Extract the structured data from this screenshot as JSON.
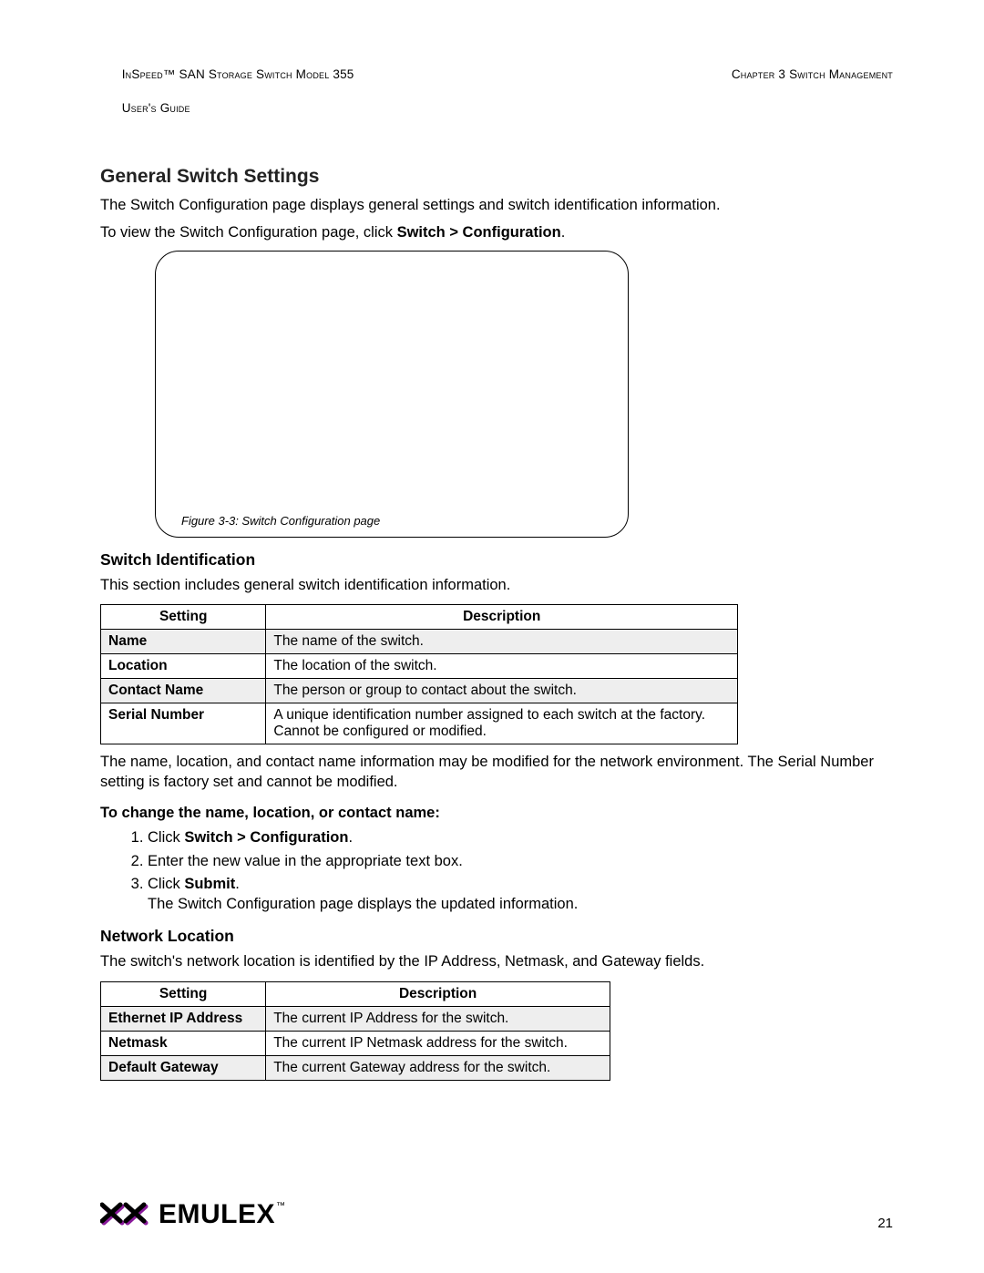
{
  "header": {
    "left_line1": "InSpeed™ SAN Storage Switch Model 355",
    "left_line2": "User's Guide",
    "right_line1": "Chapter 3 Switch Management"
  },
  "section_title": "General Switch Settings",
  "intro_p1": "The Switch Configuration page displays general settings and switch identification information.",
  "intro_p2_pre": "To view the Switch Configuration page, click ",
  "intro_p2_bold": "Switch > Configuration",
  "intro_p2_post": ".",
  "figure_caption": "Figure 3-3: Switch Configuration page",
  "switch_id": {
    "heading": "Switch Identification",
    "intro": "This section includes general switch identification information.",
    "col_setting": "Setting",
    "col_desc": "Description",
    "rows": [
      {
        "k": "Name",
        "v": "The name of the switch."
      },
      {
        "k": "Location",
        "v": "The location of the switch."
      },
      {
        "k": "Contact Name",
        "v": "The person or group to contact about the switch."
      },
      {
        "k": "Serial Number",
        "v": "A unique identification number assigned to each switch at the factory. Cannot be configured or modified."
      }
    ],
    "after": "The name, location, and contact name information may be modified for the network environment. The Serial Number setting is factory set and cannot be modified."
  },
  "change_instr": {
    "lead": "To change the name, location, or contact name:",
    "steps": {
      "s1_pre": "Click ",
      "s1_bold": "Switch > Configuration",
      "s1_post": ".",
      "s2": "Enter the new value in the appropriate text box.",
      "s3_pre": "Click ",
      "s3_bold": "Submit",
      "s3_post": ".",
      "s3_line2": "The Switch Configuration page displays the updated information."
    }
  },
  "network_loc": {
    "heading": "Network Location",
    "intro": "The switch's network location is identified by the IP Address, Netmask, and Gateway fields.",
    "col_setting": "Setting",
    "col_desc": "Description",
    "rows": [
      {
        "k": "Ethernet IP Address",
        "v": "The current IP Address for the switch."
      },
      {
        "k": "Netmask",
        "v": "The current IP Netmask address for the switch."
      },
      {
        "k": "Default Gateway",
        "v": "The current Gateway address for the switch."
      }
    ]
  },
  "footer": {
    "brand": "EMULEX",
    "pagenum": "21"
  }
}
